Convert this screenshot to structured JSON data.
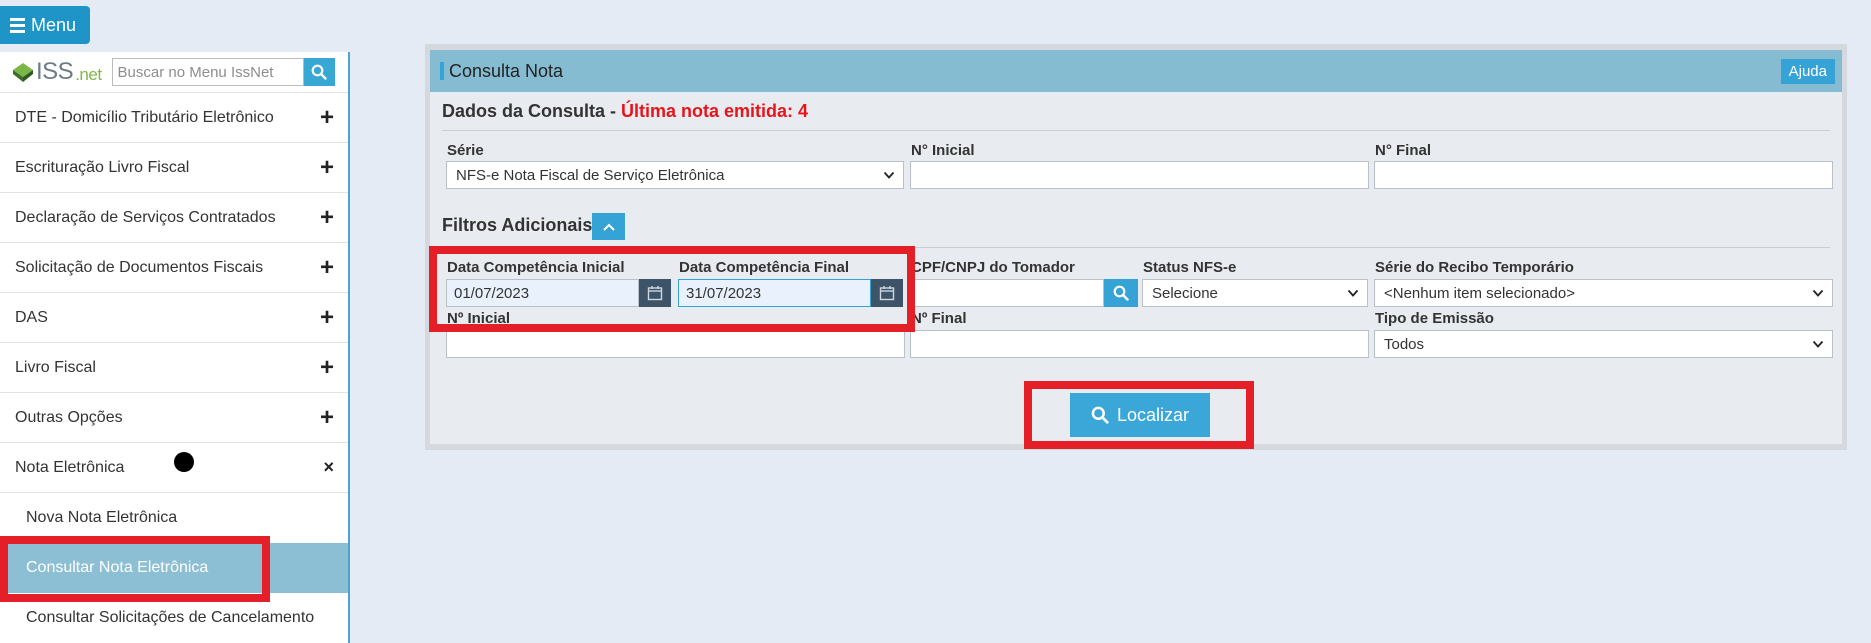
{
  "menu": {
    "label": "Menu"
  },
  "sidebar": {
    "logo_main": "ISS",
    "logo_suffix": ".net",
    "search_placeholder": "Buscar no Menu IssNet",
    "items": [
      {
        "label": "DTE - Domicílio Tributário Eletrônico",
        "state": "+"
      },
      {
        "label": "Escrituração Livro Fiscal",
        "state": "+"
      },
      {
        "label": "Declaração de Serviços Contratados",
        "state": "+"
      },
      {
        "label": "Solicitação de Documentos Fiscais",
        "state": "+"
      },
      {
        "label": "DAS",
        "state": "+"
      },
      {
        "label": "Livro Fiscal",
        "state": "+"
      },
      {
        "label": "Outras Opções",
        "state": "+"
      },
      {
        "label": "Nota Eletrônica",
        "state": "×"
      }
    ],
    "sub_items": [
      {
        "label": "Nova Nota Eletrônica"
      },
      {
        "label": "Consultar Nota Eletrônica"
      },
      {
        "label": "Consultar Solicitações de Cancelamento"
      }
    ]
  },
  "panel": {
    "title": "Consulta Nota",
    "help_label": "Ajuda",
    "query_section": "Dados da Consulta - ",
    "last_note": "Última nota emitida: 4",
    "serie_label": "Série",
    "serie_value": "NFS-e Nota Fiscal de Serviço Eletrônica",
    "n_inicial_label": "N° Inicial",
    "n_final_label": "N° Final",
    "filters_section": "Filtros Adicionais",
    "data_inicial_label": "Data Competência Inicial",
    "data_inicial_value": "01/07/2023",
    "data_final_label": "Data Competência Final",
    "data_final_value": "31/07/2023",
    "cpf_label": "CPF/CNPJ do Tomador",
    "status_label": "Status NFS-e",
    "status_value": "Selecione",
    "recibo_label": "Série do Recibo Temporário",
    "recibo_value": "<Nenhum item selecionado>",
    "n_inicial2_label": "Nº Inicial",
    "n_final2_label": "Nº Final",
    "tipo_label": "Tipo de Emissão",
    "tipo_value": "Todos",
    "locate_label": "Localizar"
  },
  "colors": {
    "accent": "#36a3d6",
    "highlight": "#e51f27",
    "header": "#85bcd2"
  }
}
